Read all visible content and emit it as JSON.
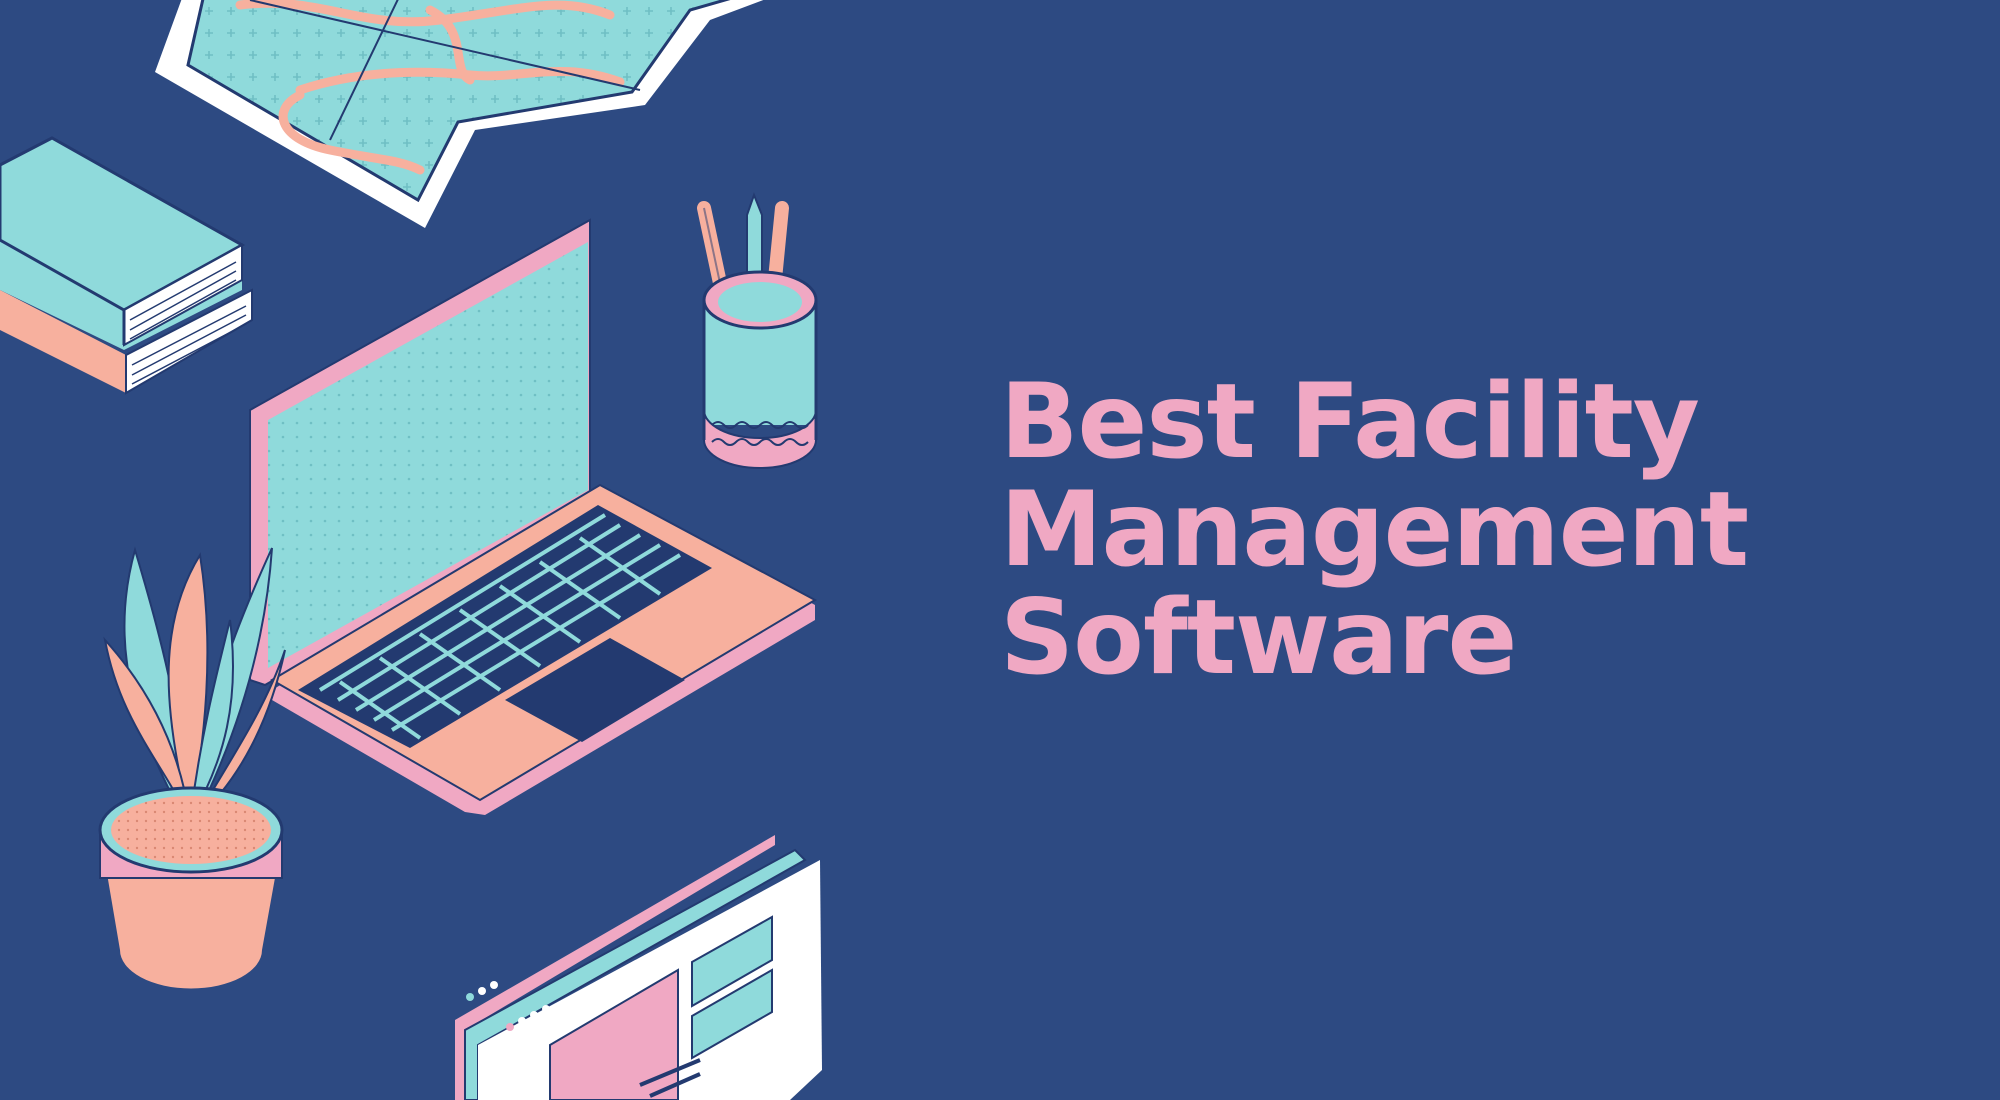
{
  "headline": {
    "line1": "Best Facility",
    "line2": "Management",
    "line3": "Software"
  },
  "colors": {
    "background": "#2d4a82",
    "title": "#f0a8c3",
    "teal": "#8fdadb",
    "peach": "#f7b09e",
    "pink": "#f0a8c3",
    "white": "#ffffff"
  },
  "icons": [
    "folded-map-icon",
    "book-stack-icon",
    "pencil-cup-icon",
    "laptop-icon",
    "potted-plant-icon",
    "browser-window-icon"
  ]
}
